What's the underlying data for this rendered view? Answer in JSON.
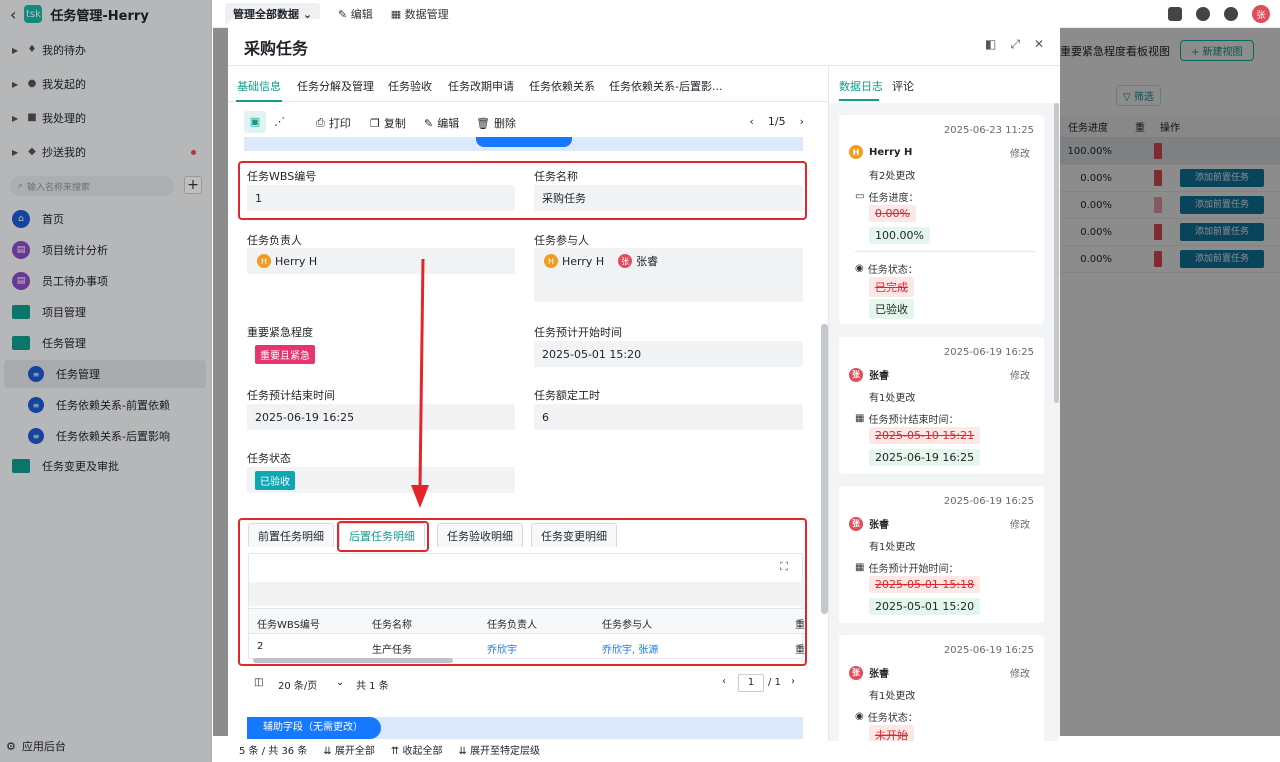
{
  "app": {
    "title": "任务管理-Herry",
    "logo": "tsk"
  },
  "sidebar": {
    "groups": [
      {
        "label": "我的待办",
        "icon": "bell-icon"
      },
      {
        "label": "我发起的",
        "icon": "send-icon"
      },
      {
        "label": "我处理的",
        "icon": "task-icon"
      },
      {
        "label": "抄送我的",
        "icon": "cc-icon"
      }
    ],
    "search_placeholder": "输入名称来搜索",
    "nav": [
      {
        "label": "首页"
      },
      {
        "label": "项目统计分析"
      },
      {
        "label": "员工待办事项"
      },
      {
        "label": "项目管理"
      },
      {
        "label": "任务管理"
      },
      {
        "label": "任务管理"
      },
      {
        "label": "任务依赖关系-前置依赖"
      },
      {
        "label": "任务依赖关系-后置影响"
      },
      {
        "label": "任务变更及审批"
      }
    ],
    "footer": "应用后台"
  },
  "bg": {
    "view_label": "管理全部数据",
    "edit": "编辑",
    "data_mgmt": "数据管理",
    "view_name": "重要紧急程度看板视图",
    "new_view": "+ 新建视图",
    "filter": "筛选",
    "col_progress": "任务进度",
    "col_imp": "重",
    "col_ops": "操作",
    "rows": [
      "100.00%",
      "0.00%",
      "0.00%",
      "0.00%",
      "0.00%"
    ],
    "add_btn": "添加前置任务",
    "footer_count": "5 条 / 共 36 条",
    "expand_all": "展开全部",
    "collapse_all": "收起全部",
    "expand_level": "展开至特定层级",
    "user_initial": "张"
  },
  "modal": {
    "title": "采购任务",
    "tabs": [
      "基础信息",
      "任务分解及管理",
      "任务验收",
      "任务改期申请",
      "任务依赖关系",
      "任务依赖关系-后置影..."
    ],
    "toolbar": {
      "print": "打印",
      "copy": "复制",
      "edit": "编辑",
      "delete": "删除",
      "page": "1/5"
    },
    "fields": {
      "wbs_label": "任务WBS编号",
      "wbs": "1",
      "name_label": "任务名称",
      "name": "采购任务",
      "owner_label": "任务负责人",
      "owner": "Herry H",
      "members_label": "任务参与人",
      "member1": "Herry H",
      "member2": "张睿",
      "priority_label": "重要紧急程度",
      "priority": "重要且紧急",
      "start_label": "任务预计开始时间",
      "start": "2025-05-01 15:20",
      "end_label": "任务预计结束时间",
      "end": "2025-06-19 16:25",
      "hours_label": "任务额定工时",
      "hours": "6",
      "status_label": "任务状态",
      "status": "已验收"
    },
    "subtabs": [
      "前置任务明细",
      "后置任务明细",
      "任务验收明细",
      "任务变更明细"
    ],
    "subtable": {
      "headers": [
        "任务WBS编号",
        "任务名称",
        "任务负责人",
        "任务参与人",
        "重"
      ],
      "row": {
        "wbs": "2",
        "name": "生产任务",
        "owner": "乔欣宇",
        "members": "乔欣宇, 张源",
        "more": "重"
      }
    },
    "pager": {
      "size": "20 条/页",
      "total": "共 1 条",
      "page": "1",
      "pages": "/ 1"
    },
    "aux": "辅助字段（无需更改）"
  },
  "log": {
    "tabs": [
      "数据日志",
      "评论"
    ],
    "entries": [
      {
        "time": "2025-06-23 11:25",
        "user": "Herry H",
        "initial": "H",
        "action": "修改",
        "summary": "有2处更改",
        "f1": "任务进度：",
        "old1": "0.00%",
        "new1": "100.00%",
        "f2": "任务状态：",
        "old2": "已完成",
        "new2": "已验收"
      },
      {
        "time": "2025-06-19 16:25",
        "user": "张睿",
        "initial": "张",
        "action": "修改",
        "summary": "有1处更改",
        "f1": "任务预计结束时间：",
        "old1": "2025-05-10 15:21",
        "new1": "2025-06-19 16:25"
      },
      {
        "time": "2025-06-19 16:25",
        "user": "张睿",
        "initial": "张",
        "action": "修改",
        "summary": "有1处更改",
        "f1": "任务预计开始时间：",
        "old1": "2025-05-01 15:18",
        "new1": "2025-05-01 15:20"
      },
      {
        "time": "2025-06-19 16:25",
        "user": "张睿",
        "initial": "张",
        "action": "修改",
        "summary": "有1处更改",
        "f1": "任务状态：",
        "old1": "未开始"
      }
    ]
  }
}
